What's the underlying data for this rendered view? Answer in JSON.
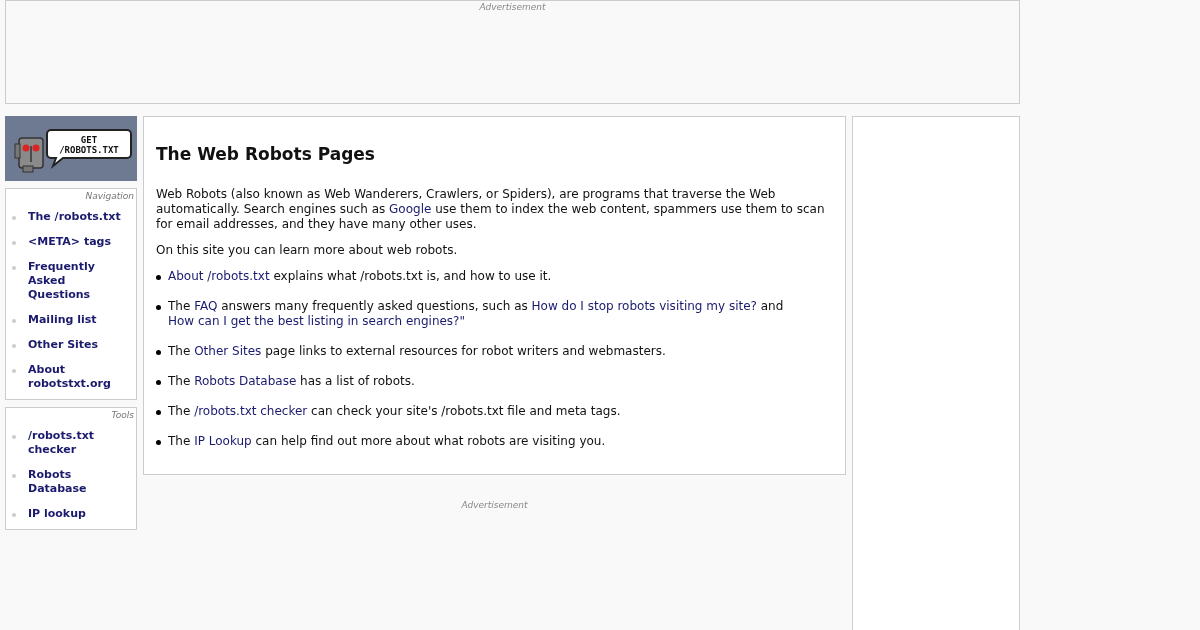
{
  "top_ad": {
    "label": "Advertisement"
  },
  "logo": {
    "line_1": "GET",
    "line_2": "/ROBOTS.TXT"
  },
  "sidebar": [
    {
      "title": "Navigation",
      "items": [
        "The /robots.txt",
        "<META> tags",
        "Frequently Asked Questions",
        "Mailing list",
        "Other Sites",
        "About robotstxt.org"
      ]
    },
    {
      "title": "Tools",
      "items": [
        "/robots.txt checker",
        "Robots Database",
        "IP lookup"
      ]
    }
  ],
  "main": {
    "title": "The Web Robots Pages",
    "paragraphs": [
      [
        {
          "text": "Web Robots (also known as Web Wanderers, Crawlers, or Spiders), are programs that traverse the Web automatically. Search engines such as ",
          "link": false
        },
        {
          "text": "Google",
          "link": true
        },
        {
          "text": " use them to index the web content, spammers use them to scan for email addresses, and they have many other uses.",
          "link": false
        }
      ],
      [
        {
          "text": "On this site you can learn more about web robots.",
          "link": false
        }
      ]
    ],
    "bullets": [
      [
        {
          "text": "About /robots.txt",
          "link": true
        },
        {
          "text": " explains what /robots.txt is, and how to use it.",
          "link": false
        }
      ],
      [
        {
          "text": "The ",
          "link": false
        },
        {
          "text": "FAQ",
          "link": true
        },
        {
          "text": " answers many frequently asked questions, such as ",
          "link": false
        },
        {
          "text": "How do I stop robots visiting my site?",
          "link": true
        },
        {
          "text": " and ",
          "link": false
        },
        {
          "text": "How can I get the best listing in search engines?\"",
          "link": true
        }
      ],
      [
        {
          "text": "The ",
          "link": false
        },
        {
          "text": "Other Sites",
          "link": true
        },
        {
          "text": " page links to external resources for robot writers and webmasters.",
          "link": false
        }
      ],
      [
        {
          "text": "The ",
          "link": false
        },
        {
          "text": "Robots Database",
          "link": true
        },
        {
          "text": " has a list of robots.",
          "link": false
        }
      ],
      [
        {
          "text": "The ",
          "link": false
        },
        {
          "text": "/robots.txt checker",
          "link": true
        },
        {
          "text": " can check your site's /robots.txt file and meta tags.",
          "link": false
        }
      ],
      [
        {
          "text": "The ",
          "link": false
        },
        {
          "text": "IP Lookup",
          "link": true
        },
        {
          "text": " can help find out more about what robots are visiting you.",
          "link": false
        }
      ]
    ]
  },
  "bottom_ad": {
    "label": "Advertisement"
  }
}
